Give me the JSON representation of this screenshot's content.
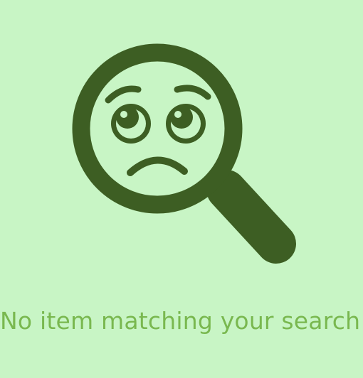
{
  "empty_state": {
    "message": "No item matching your search !",
    "icon": "sad-magnifying-glass-icon",
    "colors": {
      "background": "#c8f5c5",
      "icon": "#3d5e23",
      "message": "#79b84f"
    }
  }
}
